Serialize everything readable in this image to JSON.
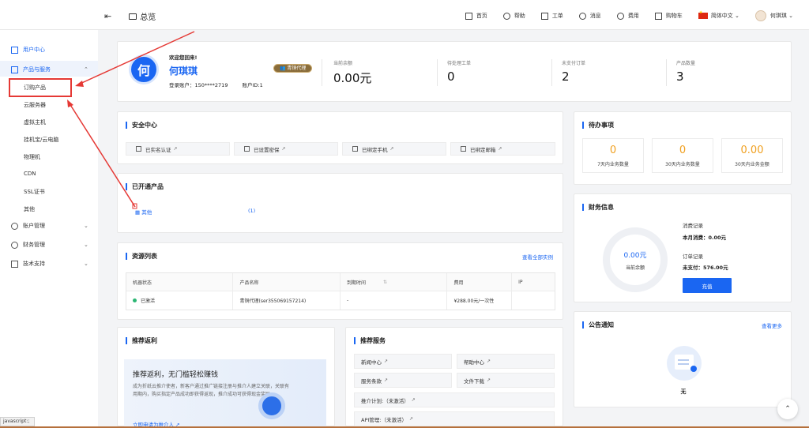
{
  "topbar": {
    "page_title": "总览",
    "menu": [
      "首页",
      "帮助",
      "工单",
      "消息",
      "费用",
      "购物车"
    ],
    "language": "简体中文",
    "user": "何琪琪"
  },
  "sidebar": {
    "user_center": "用户中心",
    "products_services": "产品与服务",
    "sub_items": [
      "订购产品",
      "云服务器",
      "虚拟主机",
      "挂机宝/云电脑",
      "物理机",
      "CDN",
      "SSL证书",
      "其他"
    ],
    "account": "账户管理",
    "finance": "财务管理",
    "support": "技术支持"
  },
  "profile": {
    "avatar_char": "何",
    "welcome": "欢迎您回来!",
    "name": "何琪琪",
    "account_label": "登录账户：150****2719",
    "account_id": "账户ID:1",
    "badge": "青铜代理",
    "stats": [
      {
        "label": "当前余额",
        "value": "0.00元"
      },
      {
        "label": "待处理工单",
        "value": "0"
      },
      {
        "label": "未支付订单",
        "value": "2"
      },
      {
        "label": "产品数量",
        "value": "3"
      }
    ]
  },
  "security": {
    "title": "安全中心",
    "items": [
      "已实名认证",
      "已设置密保",
      "已绑定手机",
      "已绑定邮箱"
    ]
  },
  "opened": {
    "title": "已开通产品",
    "item": "其他",
    "count": "(1)"
  },
  "resources": {
    "title": "资源列表",
    "view_all": "查看全部实例",
    "headers": [
      "机器状态",
      "产品名称",
      "到期时间",
      "费用",
      "IP"
    ],
    "sort_icon": "⇅",
    "rows": [
      {
        "status": "已激活",
        "name": "青铜代理(ser355069157214)",
        "expire": "-",
        "fee": "¥288.00元/一次性",
        "ip": ""
      }
    ]
  },
  "todo": {
    "title": "待办事项",
    "items": [
      {
        "value": "0",
        "label": "7天内业务数量"
      },
      {
        "value": "0",
        "label": "30天内业务数量"
      },
      {
        "value": "0.00",
        "label": "30天内业务金额"
      }
    ]
  },
  "finance": {
    "title": "财务信息",
    "balance": "0.00元",
    "balance_label": "当前余额",
    "consume_title": "消费记录",
    "consume_text": "本月消费：0.00元",
    "order_title": "订单记录",
    "order_text": "未支付：576.00元",
    "recharge": "充值"
  },
  "referral": {
    "title": "推荐返利",
    "headline": "推荐返利，无门槛轻松赚钱",
    "desc": "成为折纸云推介使者，新客户通过推广链接注册与推介人建立关联，关联有用期内，购买指定产品成功即获得返现，推介成功可获得现金奖励",
    "apply": "立即申请为推介人"
  },
  "services": {
    "title": "推荐服务",
    "items": [
      "新闻中心",
      "帮助中心",
      "服务条款",
      "文件下载",
      "推介计划:（未激活）",
      "API管理:（未激活）"
    ]
  },
  "notice": {
    "title": "公告通知",
    "more": "查看更多",
    "empty": "无"
  },
  "status_tip": "javascript:;",
  "colors": {
    "primary": "#1a66f2",
    "annotation": "#e53935",
    "todo": "#f0a020",
    "active": "#2bb673"
  }
}
